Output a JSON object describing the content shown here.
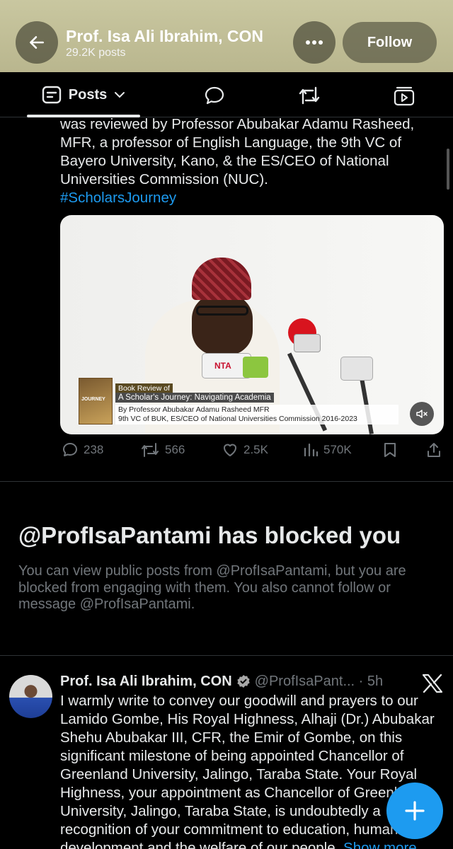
{
  "header": {
    "title": "Prof. Isa Ali Ibrahim, CON",
    "subtitle": "29.2K posts",
    "follow_label": "Follow",
    "back_icon": "arrow-left-icon",
    "more_icon": "ellipsis-icon"
  },
  "tabs": {
    "posts_label": "Posts",
    "icons": [
      "posts-icon",
      "chevron-down-icon",
      "reply-icon",
      "retweet-icon",
      "video-icon"
    ]
  },
  "post1": {
    "text": "was reviewed by Professor Abubakar Adamu Rasheed, MFR, a professor of English Language, the 9th VC of Bayero University, Kano, & the ES/CEO of National Universities Commission (NUC).",
    "hashtag": "#ScholarsJourney",
    "media": {
      "book_text": "JOURNEY",
      "caption_line1": "Book Review of",
      "caption_line2": "A Scholar's Journey: Navigating Academia",
      "caption_line3": "By Professor Abubakar Adamu Rasheed MFR",
      "caption_line4": "9th VC of BUK, ES/CEO of National Universities Commission 2016-2023",
      "mic_label": "NTA"
    },
    "actions": {
      "replies": "238",
      "reposts": "566",
      "likes": "2.5K",
      "views": "570K"
    }
  },
  "blocked": {
    "title": "@ProfIsaPantami has blocked you",
    "description": "You can view public posts from @ProfIsaPantami, but you are blocked from engaging with them. You also cannot follow or message @ProfIsaPantami."
  },
  "post2": {
    "name": "Prof. Isa Ali Ibrahim, CON",
    "handle": "@ProfIsaPant... · 5h",
    "text": "I warmly write to convey our goodwill and prayers to our Lamido Gombe, His Royal Highness, Alhaji (Dr.) Abubakar Shehu Abubakar III, CFR, the Emir of Gombe, on this significant milestone of being appointed Chancellor of Greenland University, Jalingo, Taraba State. Your Royal Highness, your appointment as Chancellor of Greenland University, Jalingo, Taraba State, is undoubtedly a recognition of your commitment to education, human development and the welfare of our people.",
    "show_more": "Show more"
  },
  "colors": {
    "accent": "#1d9bf0",
    "muted": "#71767b",
    "background": "#000000",
    "header_bg": "#c2bf97"
  }
}
